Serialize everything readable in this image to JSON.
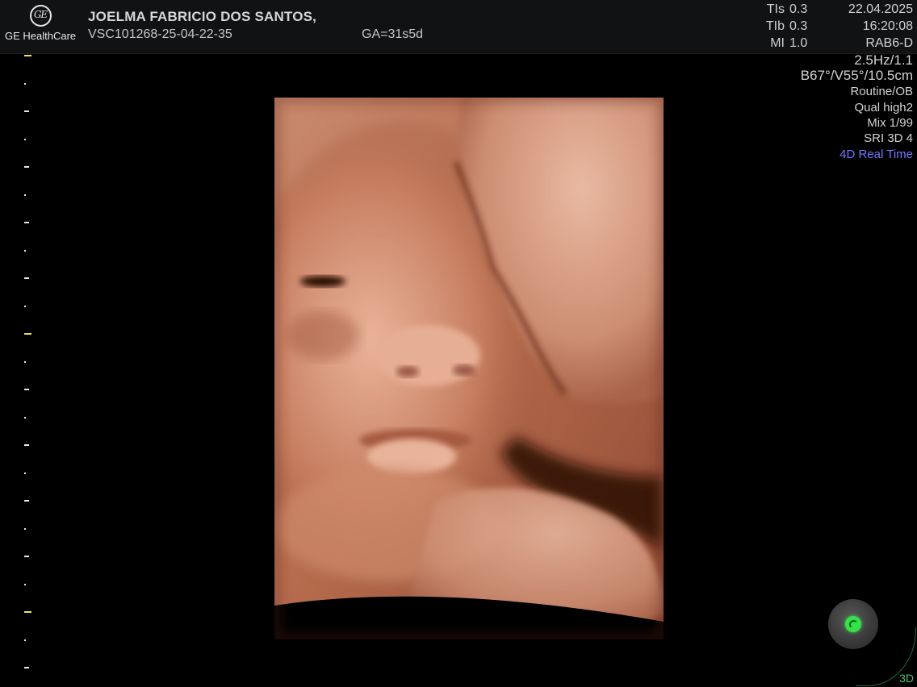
{
  "header": {
    "brand": "GE HealthCare",
    "logo_mark": "GE",
    "patient_name": "JOELMA FABRICIO DOS SANTOS,",
    "exam_id": "VSC101268-25-04-22-35",
    "gestational_age": "GA=31s5d"
  },
  "indices": [
    {
      "label": "TIs",
      "value": "0.3"
    },
    {
      "label": "TIb",
      "value": "0.3"
    },
    {
      "label": "MI",
      "value": "1.0"
    }
  ],
  "datetime": {
    "date": "22.04.2025",
    "time": "16:20:08"
  },
  "probe": "RAB6-D",
  "params": {
    "frequency": "2.5Hz/1.1",
    "volume": "B67°/V55°/10.5cm",
    "preset": "Routine/OB",
    "quality": "Qual high2",
    "mix": "Mix 1/99",
    "sri": "SRI 3D 4",
    "mode": "4D Real Time"
  },
  "mode_corner": "3D",
  "colors": {
    "background": "#000000",
    "header": "#111214",
    "mode_text": "#7777ff",
    "tick_major": "#f0e070",
    "status_green": "#35e04a",
    "skin_light": "#e7b195",
    "skin_dark": "#7a3a26"
  }
}
